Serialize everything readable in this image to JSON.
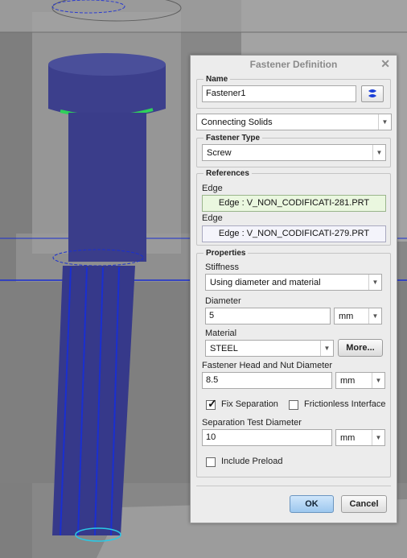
{
  "dialog": {
    "title": "Fastener Definition",
    "close_icon": "close-icon"
  },
  "name_group": {
    "legend": "Name",
    "value": "Fastener1",
    "color_picker_icon": "color-swatch-icon"
  },
  "connection": {
    "selected": "Connecting Solids"
  },
  "fastener_type": {
    "legend": "Fastener Type",
    "selected": "Screw"
  },
  "references": {
    "legend": "References",
    "items": [
      {
        "label": "Edge",
        "value": "Edge : V_NON_CODIFICATI-281.PRT"
      },
      {
        "label": "Edge",
        "value": "Edge : V_NON_CODIFICATI-279.PRT"
      }
    ]
  },
  "properties": {
    "legend": "Properties",
    "stiffness_label": "Stiffness",
    "stiffness_selected": "Using diameter and material",
    "diameter_label": "Diameter",
    "diameter_value": "5",
    "diameter_unit": "mm",
    "material_label": "Material",
    "material_selected": "STEEL",
    "more_label": "More...",
    "head_nut_label": "Fastener Head and Nut Diameter",
    "head_nut_value": "8.5",
    "head_nut_unit": "mm",
    "fix_separation_label": "Fix Separation",
    "fix_separation_checked": true,
    "frictionless_label": "Frictionless Interface",
    "frictionless_checked": false,
    "sep_test_label": "Separation Test Diameter",
    "sep_test_value": "10",
    "sep_test_unit": "mm",
    "include_preload_label": "Include Preload",
    "include_preload_checked": false
  },
  "buttons": {
    "ok": "OK",
    "cancel": "Cancel"
  },
  "colors": {
    "bolt_body": "#3c3f8c",
    "edge_highlight": "#2fd05a",
    "datum_line": "#1a2fd0",
    "ok_button": "#a9cff0"
  }
}
